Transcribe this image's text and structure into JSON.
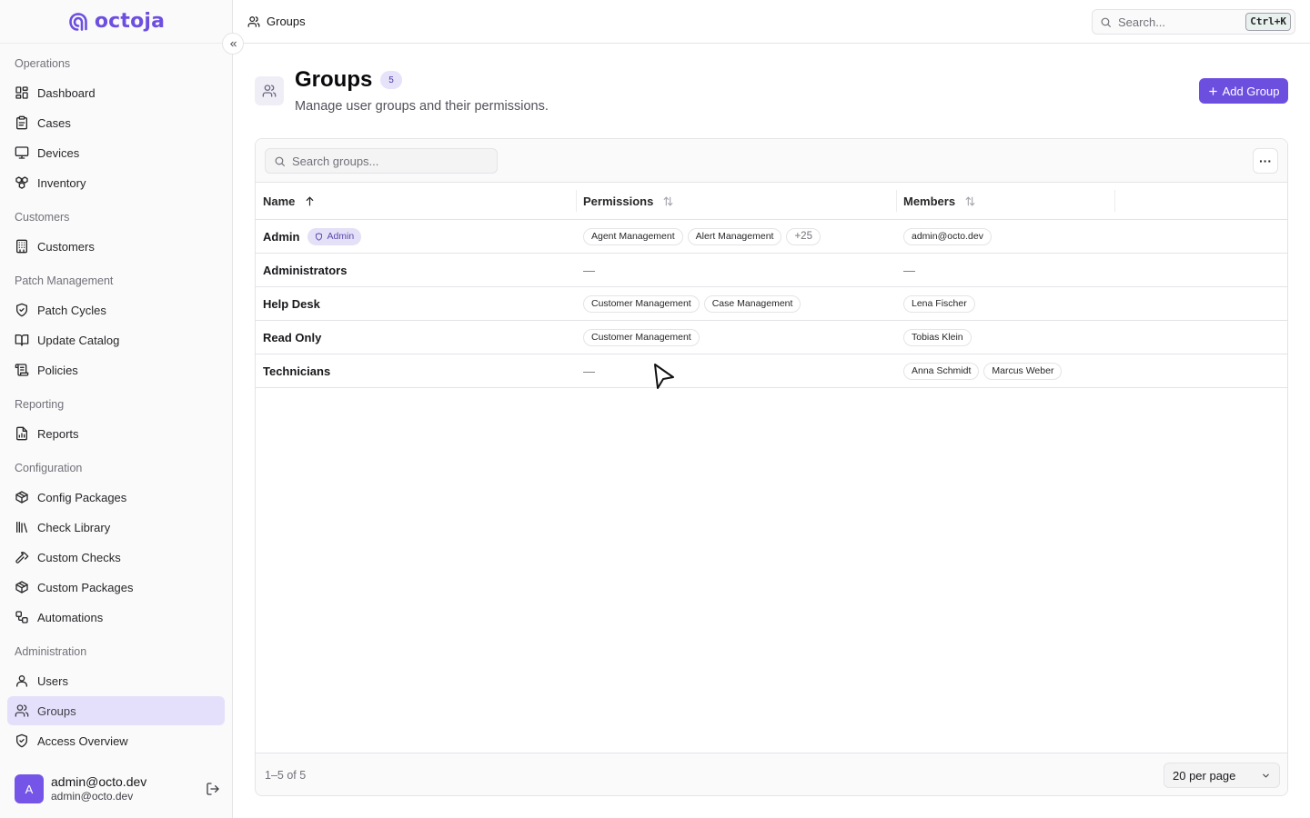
{
  "brand": {
    "name": "octoja",
    "color": "#6d4fe0"
  },
  "sidebar": {
    "groups": [
      {
        "label": "Operations",
        "items": [
          {
            "label": "Dashboard",
            "icon": "layout-dashboard-icon"
          },
          {
            "label": "Cases",
            "icon": "clipboard-icon"
          },
          {
            "label": "Devices",
            "icon": "monitor-icon"
          },
          {
            "label": "Inventory",
            "icon": "boxes-icon"
          }
        ]
      },
      {
        "label": "Customers",
        "items": [
          {
            "label": "Customers",
            "icon": "building-icon"
          }
        ]
      },
      {
        "label": "Patch Management",
        "items": [
          {
            "label": "Patch Cycles",
            "icon": "shield-check-icon"
          },
          {
            "label": "Update Catalog",
            "icon": "book-open-icon"
          },
          {
            "label": "Policies",
            "icon": "scroll-icon"
          }
        ]
      },
      {
        "label": "Reporting",
        "items": [
          {
            "label": "Reports",
            "icon": "file-chart-icon"
          }
        ]
      },
      {
        "label": "Configuration",
        "items": [
          {
            "label": "Config Packages",
            "icon": "package-icon"
          },
          {
            "label": "Check Library",
            "icon": "library-icon"
          },
          {
            "label": "Custom Checks",
            "icon": "hammer-icon"
          },
          {
            "label": "Custom Packages",
            "icon": "package-icon"
          },
          {
            "label": "Automations",
            "icon": "workflow-icon"
          }
        ]
      },
      {
        "label": "Administration",
        "items": [
          {
            "label": "Users",
            "icon": "user-icon"
          },
          {
            "label": "Groups",
            "icon": "users-icon",
            "active": true
          },
          {
            "label": "Access Overview",
            "icon": "shield-icon"
          }
        ]
      }
    ],
    "user": {
      "initial": "A",
      "name": "admin@octo.dev",
      "email": "admin@octo.dev"
    }
  },
  "topbar": {
    "breadcrumb": "Groups",
    "search_placeholder": "Search...",
    "shortcut": "Ctrl+K"
  },
  "page": {
    "title": "Groups",
    "count": "5",
    "subtitle": "Manage user groups and their permissions.",
    "add_button": "Add Group"
  },
  "table": {
    "search_placeholder": "Search groups...",
    "more_label": "···",
    "columns": {
      "name": "Name",
      "permissions": "Permissions",
      "members": "Members"
    },
    "rows": [
      {
        "name": "Admin",
        "badge": "Admin",
        "permissions": [
          "Agent Management",
          "Alert Management"
        ],
        "more_permissions": "+25",
        "members": [
          "admin@octo.dev"
        ]
      },
      {
        "name": "Administrators",
        "permissions": [],
        "members": []
      },
      {
        "name": "Help Desk",
        "permissions": [
          "Customer Management",
          "Case Management"
        ],
        "members": [
          "Lena Fischer"
        ]
      },
      {
        "name": "Read Only",
        "permissions": [
          "Customer Management"
        ],
        "members": [
          "Tobias Klein"
        ]
      },
      {
        "name": "Technicians",
        "permissions": [],
        "members": [
          "Anna Schmidt",
          "Marcus Weber"
        ]
      }
    ],
    "empty_placeholder": "—",
    "range_text": "1–5 of 5",
    "per_page": "20 per page"
  }
}
